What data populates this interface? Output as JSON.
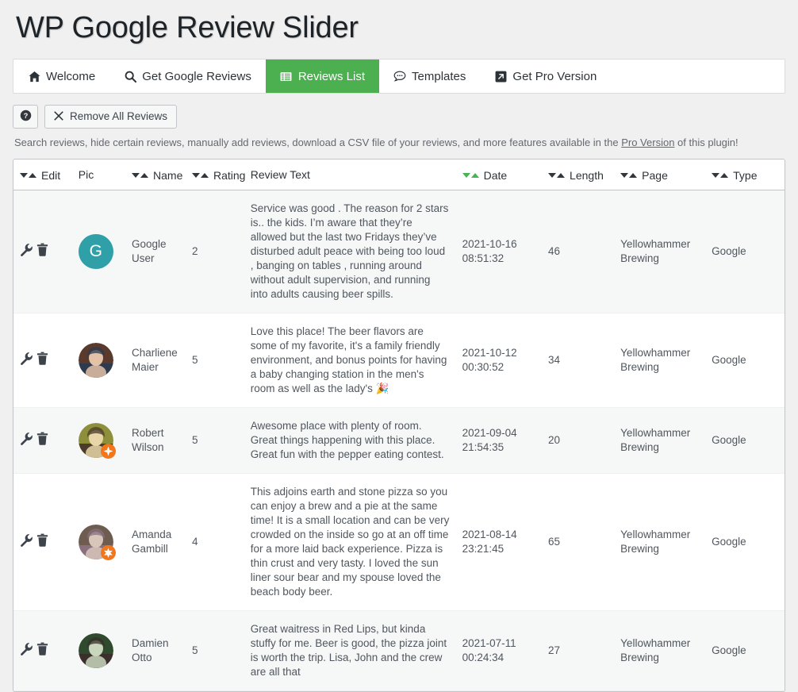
{
  "header": {
    "title": "WP Google Review Slider"
  },
  "tabs": [
    {
      "label": "Welcome",
      "icon": "home-icon",
      "active": false
    },
    {
      "label": "Get Google Reviews",
      "icon": "search-icon",
      "active": false
    },
    {
      "label": "Reviews List",
      "icon": "list-icon",
      "active": true
    },
    {
      "label": "Templates",
      "icon": "comment-icon",
      "active": false
    },
    {
      "label": "Get Pro Version",
      "icon": "external-link-icon",
      "active": false
    }
  ],
  "toolbar": {
    "help_label": "?",
    "remove_all_label": "Remove All Reviews",
    "remove_icon": "close-x-icon"
  },
  "notice": {
    "text_before": "Search reviews, hide certain reviews, manually add reviews, download a CSV file of your reviews, and more features available in the ",
    "link_label": "Pro Version",
    "text_after": " of this plugin!"
  },
  "table": {
    "columns": [
      {
        "label": "Edit",
        "sortable": true,
        "sorted": false
      },
      {
        "label": "Pic",
        "sortable": false,
        "sorted": false
      },
      {
        "label": "Name",
        "sortable": true,
        "sorted": false
      },
      {
        "label": "Rating",
        "sortable": true,
        "sorted": false
      },
      {
        "label": "Review Text",
        "sortable": false,
        "sorted": false
      },
      {
        "label": "Date",
        "sortable": true,
        "sorted": true
      },
      {
        "label": "Length",
        "sortable": true,
        "sorted": false
      },
      {
        "label": "Page",
        "sortable": true,
        "sorted": false
      },
      {
        "label": "Type",
        "sortable": true,
        "sorted": false
      }
    ],
    "rows": [
      {
        "avatar_type": "letter",
        "avatar_letter": "G",
        "avatar_color": "#30a0a8",
        "badge": "none",
        "name": "Google User",
        "rating": "2",
        "text": "Service was good . The reason for 2 stars is.. the kids. I’m aware that they’re allowed but the last two Fridays they’ve disturbed adult peace with being too loud , banging on tables , running around without adult supervision, and running into adults causing beer spills.",
        "date": "2021-10-16 08:51:32",
        "length": "46",
        "page": "Yellowhammer Brewing",
        "type": "Google"
      },
      {
        "avatar_type": "photo",
        "avatar_letter": "",
        "avatar_color": "#3c5a3a",
        "badge": "none",
        "name": "Charliene Maier",
        "rating": "5",
        "text": "Love this place! The beer flavors are some of my favorite, it's a family friendly environment, and bonus points for having a baby changing station in the men's room as well as the lady's 🎉",
        "date": "2021-10-12 00:30:52",
        "length": "34",
        "page": "Yellowhammer Brewing",
        "type": "Google"
      },
      {
        "avatar_type": "photo",
        "avatar_letter": "",
        "avatar_color": "#6b4b3e",
        "badge": "local-guide",
        "name": "Robert Wilson",
        "rating": "5",
        "text": "Awesome place with plenty of room. Great things happening with this place. Great fun with the pepper eating contest.",
        "date": "2021-09-04 21:54:35",
        "length": "20",
        "page": "Yellowhammer Brewing",
        "type": "Google"
      },
      {
        "avatar_type": "photo",
        "avatar_letter": "",
        "avatar_color": "#8a8b3c",
        "badge": "local-guide-star",
        "name": "Amanda Gambill",
        "rating": "4",
        "text": "This adjoins earth and stone pizza so you can enjoy a brew and a pie at the same time! It is a small location and can be very crowded on the inside so go at an off time for a more laid back experience. Pizza is thin crust and very tasty. I loved the sun liner sour bear and my spouse loved the beach body beer.",
        "date": "2021-08-14 23:21:45",
        "length": "65",
        "page": "Yellowhammer Brewing",
        "type": "Google"
      },
      {
        "avatar_type": "photo",
        "avatar_letter": "",
        "avatar_color": "#7d6a5e",
        "badge": "none",
        "name": "Damien Otto",
        "rating": "5",
        "text": "Great waitress in Red Lips, but kinda stuffy for me. Beer is good, the pizza joint is worth the trip. Lisa, John and the crew are all that",
        "date": "2021-07-11 00:24:34",
        "length": "27",
        "page": "Yellowhammer Brewing",
        "type": "Google"
      }
    ]
  }
}
